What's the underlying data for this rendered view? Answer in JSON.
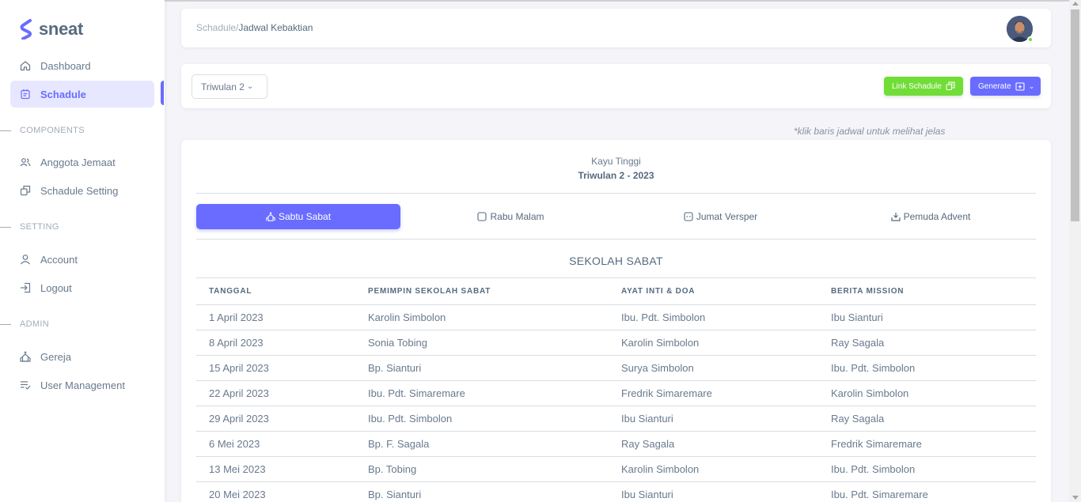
{
  "brand": {
    "name": "sneat"
  },
  "sidebar": {
    "items": [
      {
        "label": "Dashboard",
        "icon": "home-icon"
      },
      {
        "label": "Schadule",
        "icon": "calendar-icon",
        "active": true
      }
    ],
    "sections": [
      {
        "title": "COMPONENTS",
        "items": [
          {
            "label": "Anggota Jemaat",
            "icon": "users-icon"
          },
          {
            "label": "Schadule Setting",
            "icon": "copy-icon"
          }
        ]
      },
      {
        "title": "SETTING",
        "items": [
          {
            "label": "Account",
            "icon": "user-icon"
          },
          {
            "label": "Logout",
            "icon": "logout-icon"
          }
        ]
      },
      {
        "title": "ADMIN",
        "items": [
          {
            "label": "Gereja",
            "icon": "church-icon"
          },
          {
            "label": "User Management",
            "icon": "list-check-icon"
          }
        ]
      }
    ]
  },
  "header": {
    "breadcrumb_parent": "Schadule/",
    "breadcrumb_current": "Jadwal Kebaktian"
  },
  "filter": {
    "quarter_select": "Triwulan 2",
    "link_button": "Link Schadule",
    "generate_button": "Generate"
  },
  "hint": "*klik baris jadwal untuk melihat jelas",
  "card": {
    "church": "Kayu Tinggi",
    "period": "Triwulan 2 - 2023",
    "tabs": [
      {
        "label": "Sabtu Sabat",
        "icon": "church-icon",
        "active": true
      },
      {
        "label": "Rabu Malam",
        "icon": "square-icon"
      },
      {
        "label": "Jumat Versper",
        "icon": "face-icon"
      },
      {
        "label": "Pemuda Advent",
        "icon": "download-icon"
      }
    ],
    "section_title": "SEKOLAH SABAT",
    "table": {
      "headers": [
        "TANGGAL",
        "PEMIMPIN SEKOLAH SABAT",
        "AYAT INTI & DOA",
        "BERITA MISSION"
      ],
      "rows": [
        [
          "1 April 2023",
          "Karolin Simbolon",
          "Ibu. Pdt. Simbolon",
          "Ibu Sianturi"
        ],
        [
          "8 April 2023",
          "Sonia Tobing",
          "Karolin Simbolon",
          "Ray Sagala"
        ],
        [
          "15 April 2023",
          "Bp. Sianturi",
          "Surya Simbolon",
          "Ibu. Pdt. Simbolon"
        ],
        [
          "22 April 2023",
          "Ibu. Pdt. Simaremare",
          "Fredrik Simaremare",
          "Karolin Simbolon"
        ],
        [
          "29 April 2023",
          "Ibu. Pdt. Simbolon",
          "Ibu Sianturi",
          "Ray Sagala"
        ],
        [
          "6 Mei 2023",
          "Bp. F. Sagala",
          "Ray Sagala",
          "Fredrik Simaremare"
        ],
        [
          "13 Mei 2023",
          "Bp. Tobing",
          "Karolin Simbolon",
          "Ibu. Pdt. Simbolon"
        ],
        [
          "20 Mei 2023",
          "Bp. Sianturi",
          "Ibu Sianturi",
          "Ibu. Pdt. Simaremare"
        ]
      ]
    }
  },
  "colors": {
    "primary": "#696cff",
    "success": "#71dd37",
    "text": "#697a8d"
  }
}
